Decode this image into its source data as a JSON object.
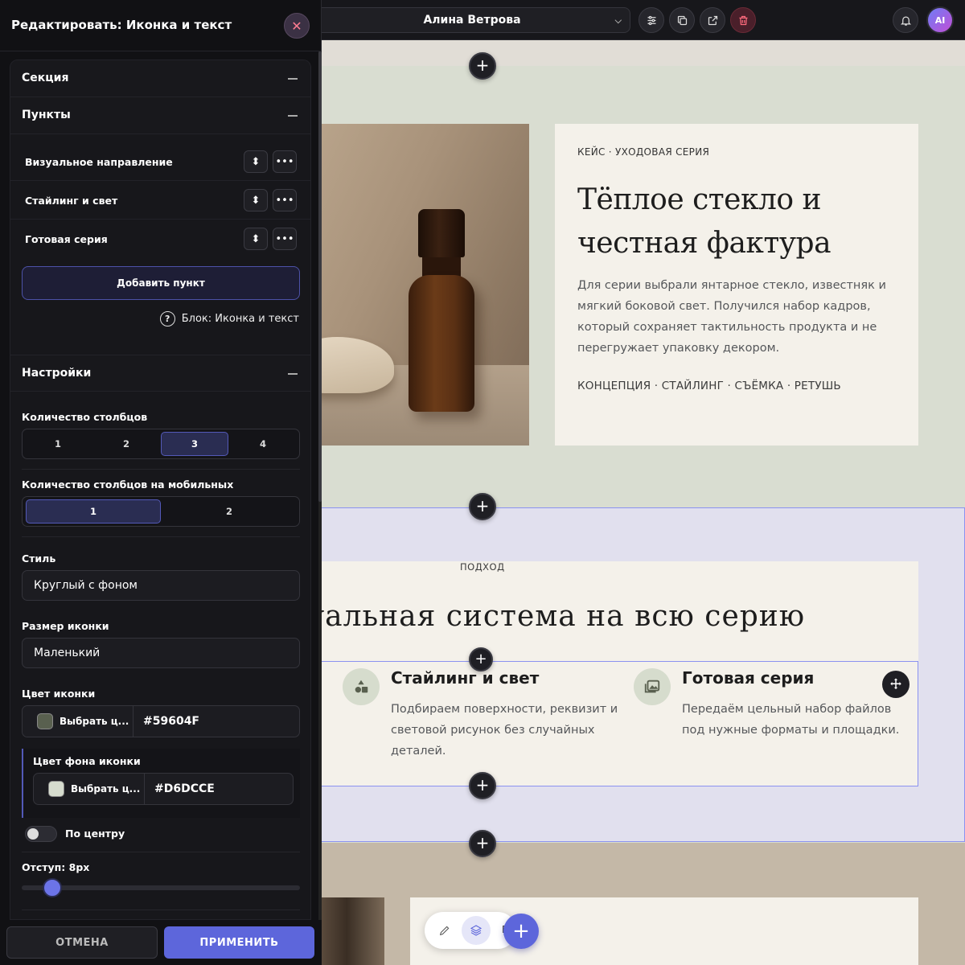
{
  "panel": {
    "title": "Редактировать: Иконка и текст",
    "close_label": "✕",
    "sections": {
      "section": "Секция",
      "items": "Пункты",
      "settings": "Настройки"
    },
    "items": [
      {
        "label": "Визуальное направление"
      },
      {
        "label": "Стайлинг и свет"
      },
      {
        "label": "Готовая серия"
      }
    ],
    "add_item": "Добавить пункт",
    "block_info": "Блок: Иконка и текст",
    "columns_label": "Количество столбцов",
    "columns_options": [
      "1",
      "2",
      "3",
      "4"
    ],
    "columns_selected": "3",
    "mobile_columns_label": "Количество столбцов на мобильных",
    "mobile_columns_options": [
      "1",
      "2"
    ],
    "mobile_columns_selected": "1",
    "style_label": "Стиль",
    "style_value": "Круглый с фоном",
    "icon_size_label": "Размер иконки",
    "icon_size_value": "Маленький",
    "icon_color_label": "Цвет иконки",
    "icon_color_pick": "Выбрать ц...",
    "icon_color_hex": "#59604F",
    "icon_bg_label": "Цвет фона иконки",
    "icon_bg_pick": "Выбрать ц...",
    "icon_bg_hex": "#D6DCCE",
    "center_label": "По центру",
    "center_on": false,
    "padding_label": "Отступ: 8px",
    "cancel": "ОТМЕНА",
    "apply": "ПРИМЕНИТЬ"
  },
  "topbar": {
    "page_select": "Алина Ветрова",
    "avatar": "AI"
  },
  "canvas": {
    "case": {
      "eyebrow": "КЕЙС · УХОДОВАЯ СЕРИЯ",
      "title": "Тёплое стекло и честная фактура",
      "body": "Для серии выбрали янтарное стекло, известняк и мягкий боковой свет. Получился набор кадров, который сохраняет тактильность продукта и не перегружает упаковку декором.",
      "tags": "КОНЦЕПЦИЯ · СТАЙЛИНГ · СЪЁМКА · РЕТУШЬ"
    },
    "approach": {
      "eyebrow": "ПОДХОД",
      "title": "уальная система на всю серию",
      "items": [
        {
          "title": "Стайлинг и свет",
          "text": "Подбираем поверхности, реквизит и световой рисунок без случайных деталей.",
          "icon": "shapes-icon"
        },
        {
          "title": "Готовая серия",
          "text": "Передаём цельный набор файлов под нужные форматы и площадки.",
          "icon": "gallery-icon"
        }
      ]
    },
    "fab_partial_text": "Е"
  },
  "colors": {
    "accent": "#5D66DB",
    "icon_color": "#59604F",
    "icon_bg": "#D6DCCE"
  }
}
